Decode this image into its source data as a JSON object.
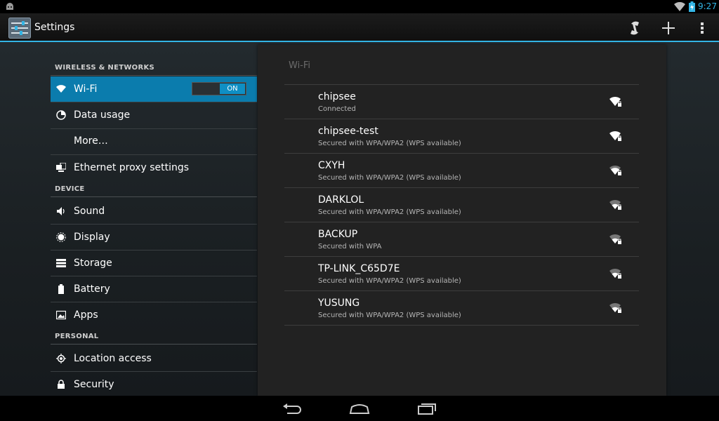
{
  "status_bar": {
    "time": "9:27"
  },
  "action_bar": {
    "title": "Settings"
  },
  "sidebar": {
    "categories": {
      "wireless": "WIRELESS & NETWORKS",
      "device": "DEVICE",
      "personal": "PERSONAL"
    },
    "items": [
      {
        "label": "Wi-Fi",
        "icon": "wifi-icon"
      },
      {
        "label": "Data usage",
        "icon": "data-usage-icon"
      },
      {
        "label": "More…",
        "icon": ""
      },
      {
        "label": "Ethernet proxy settings",
        "icon": "ethernet-icon"
      },
      {
        "label": "Sound",
        "icon": "sound-icon"
      },
      {
        "label": "Display",
        "icon": "display-icon"
      },
      {
        "label": "Storage",
        "icon": "storage-icon"
      },
      {
        "label": "Battery",
        "icon": "battery-icon"
      },
      {
        "label": "Apps",
        "icon": "apps-icon"
      },
      {
        "label": "Location access",
        "icon": "location-icon"
      },
      {
        "label": "Security",
        "icon": "lock-icon"
      }
    ],
    "wifi_toggle": "ON"
  },
  "wifi_panel": {
    "title": "Wi-Fi",
    "networks": [
      {
        "name": "chipsee",
        "status": "Connected"
      },
      {
        "name": "chipsee-test",
        "status": "Secured with WPA/WPA2 (WPS available)"
      },
      {
        "name": "CXYH",
        "status": "Secured with WPA/WPA2 (WPS available)"
      },
      {
        "name": "DARKLOL",
        "status": "Secured with WPA/WPA2 (WPS available)"
      },
      {
        "name": "BACKUP",
        "status": "Secured with WPA"
      },
      {
        "name": "TP-LINK_C65D7E",
        "status": "Secured with WPA/WPA2 (WPS available)"
      },
      {
        "name": "YUSUNG",
        "status": "Secured with WPA/WPA2 (WPS available)"
      }
    ]
  },
  "colors": {
    "accent": "#33b5e5",
    "selected": "#0b7cad"
  }
}
